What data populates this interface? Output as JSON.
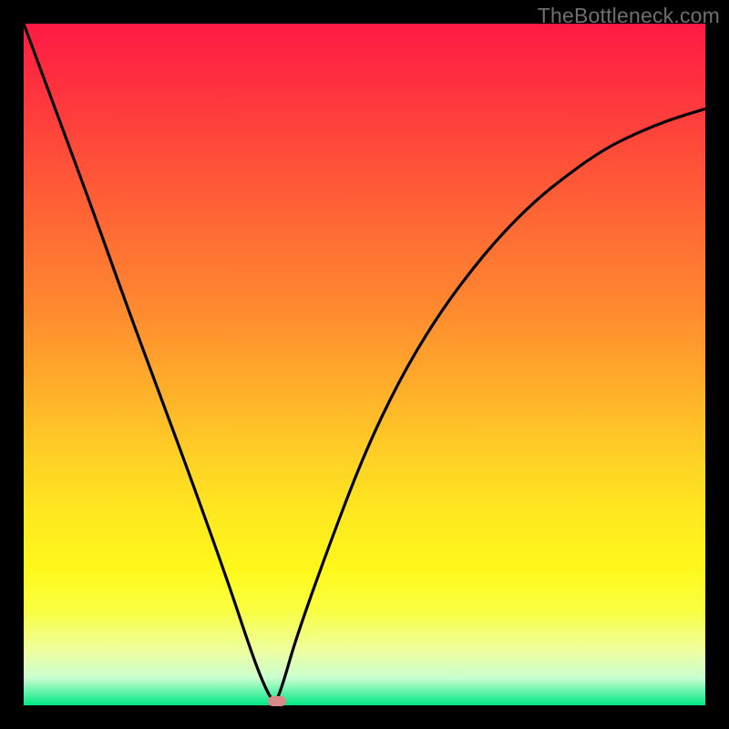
{
  "watermark": "TheBottleneck.com",
  "colors": {
    "frame": "#000000",
    "gradient_top": "#ff1a45",
    "gradient_bottom": "#00e884",
    "marker": "#d98a88",
    "curve": "#000000"
  },
  "chart_data": {
    "type": "line",
    "title": "",
    "xlabel": "",
    "ylabel": "",
    "xlim": [
      0,
      100
    ],
    "ylim": [
      0,
      100
    ],
    "x": [
      0,
      5,
      10,
      15,
      20,
      25,
      30,
      33,
      35,
      36.8,
      38,
      40,
      45,
      50,
      55,
      60,
      65,
      70,
      75,
      80,
      85,
      90,
      95,
      100
    ],
    "values": [
      100,
      86.5,
      73,
      59,
      45.5,
      32,
      18,
      9,
      3.5,
      0,
      3,
      10,
      24,
      37,
      47.5,
      56,
      63,
      69,
      74,
      78,
      81.5,
      84,
      86,
      87.5
    ],
    "minimum": {
      "x": 36.8,
      "y": 0
    },
    "marker": {
      "x": 37.2,
      "y": 0.5
    },
    "grid": false,
    "legend": false
  }
}
